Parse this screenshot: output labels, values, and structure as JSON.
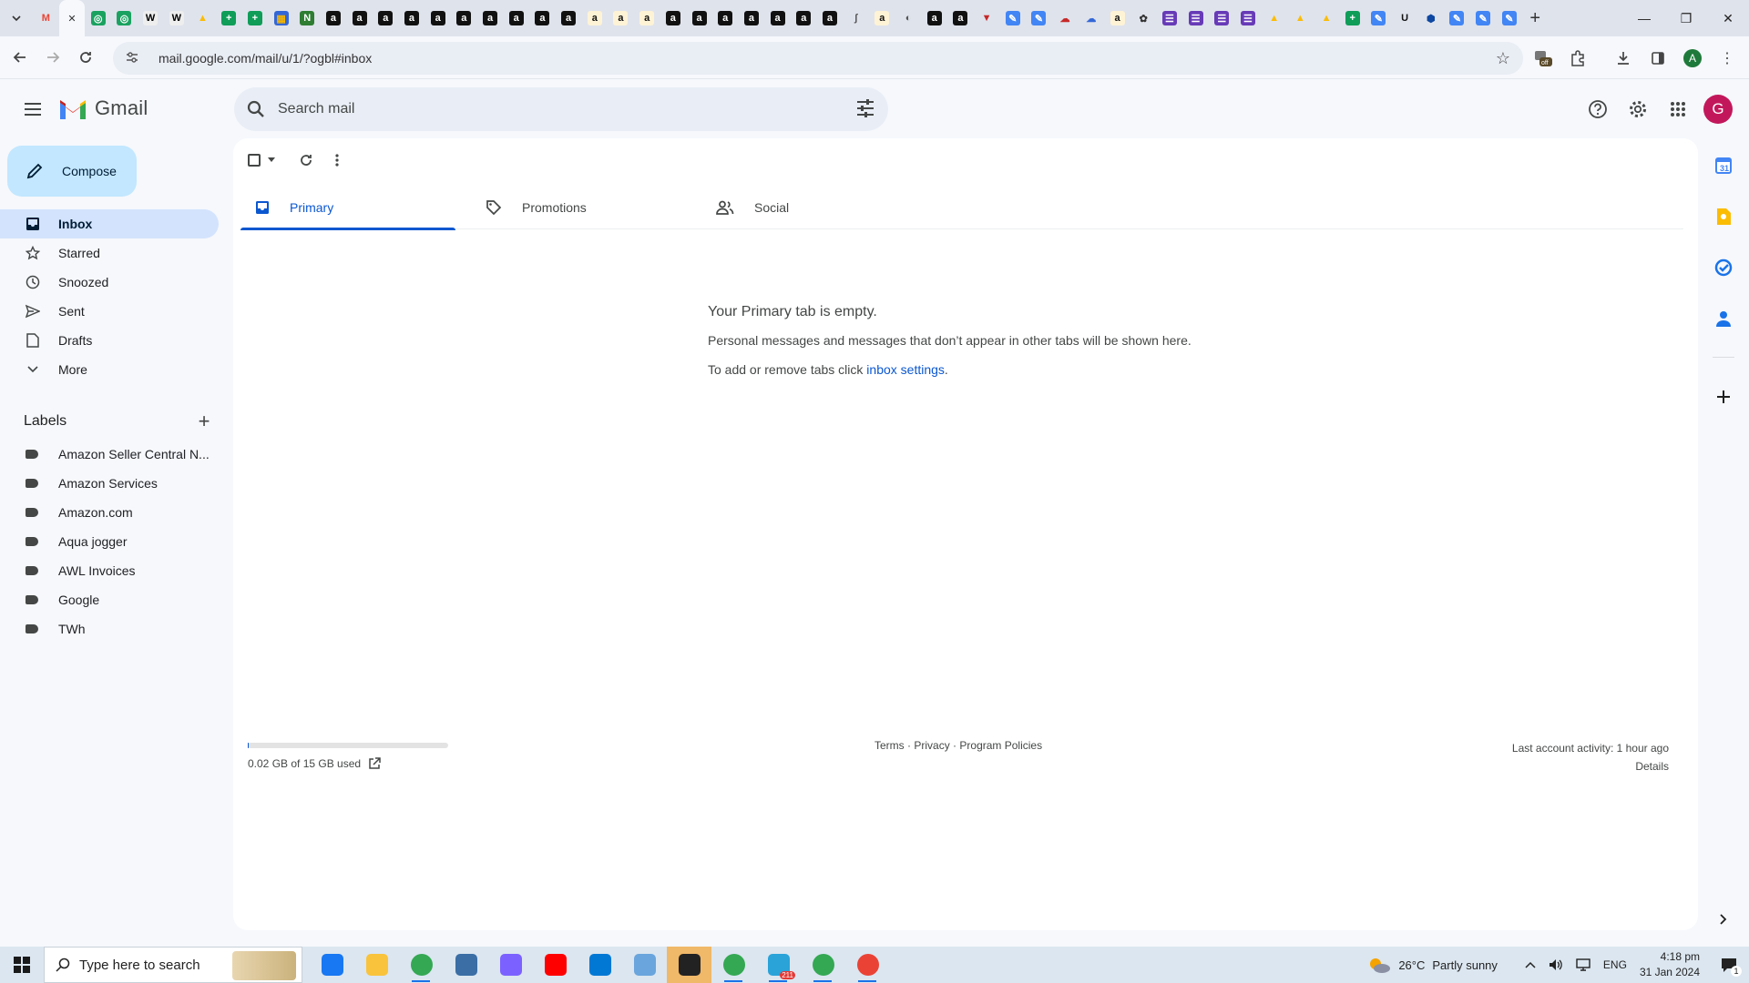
{
  "browser": {
    "url": "mail.google.com/mail/u/1/?ogbl#inbox",
    "tab_favicons": [
      {
        "icon": "gmail-icon",
        "glyph": "M",
        "color": "#ea4335",
        "bg": "transparent"
      },
      {
        "icon": "close-tab-icon",
        "glyph": "",
        "color": "#333",
        "bg": "transparent"
      },
      {
        "icon": "green-circle-icon",
        "glyph": "◎",
        "color": "#fff",
        "bg": "#1aa260"
      },
      {
        "icon": "green-circle-icon",
        "glyph": "◎",
        "color": "#fff",
        "bg": "#1aa260"
      },
      {
        "icon": "wix-icon",
        "glyph": "W",
        "color": "#000",
        "bg": "#eeeeee"
      },
      {
        "icon": "wix-icon",
        "glyph": "W",
        "color": "#000",
        "bg": "#eeeeee"
      },
      {
        "icon": "drive-icon",
        "glyph": "▲",
        "color": "#fbbc04",
        "bg": "transparent"
      },
      {
        "icon": "sheets-icon",
        "glyph": "+",
        "color": "#fff",
        "bg": "#0f9d58"
      },
      {
        "icon": "sheets-icon",
        "glyph": "+",
        "color": "#fff",
        "bg": "#0f9d58"
      },
      {
        "icon": "colorgrid-icon",
        "glyph": "▦",
        "color": "#f4b400",
        "bg": "#3367d6"
      },
      {
        "icon": "green-n-icon",
        "glyph": "N",
        "color": "#fff",
        "bg": "#2e7d32"
      },
      {
        "icon": "amazon-icon",
        "glyph": "a",
        "color": "#fff",
        "bg": "#111"
      },
      {
        "icon": "amazon-icon",
        "glyph": "a",
        "color": "#fff",
        "bg": "#111"
      },
      {
        "icon": "amazon-icon",
        "glyph": "a",
        "color": "#fff",
        "bg": "#111"
      },
      {
        "icon": "amazon-icon",
        "glyph": "a",
        "color": "#fff",
        "bg": "#111"
      },
      {
        "icon": "amazon-icon",
        "glyph": "a",
        "color": "#fff",
        "bg": "#111"
      },
      {
        "icon": "amazon-icon",
        "glyph": "a",
        "color": "#fff",
        "bg": "#111"
      },
      {
        "icon": "amazon-icon",
        "glyph": "a",
        "color": "#fff",
        "bg": "#111"
      },
      {
        "icon": "amazon-icon",
        "glyph": "a",
        "color": "#fff",
        "bg": "#111"
      },
      {
        "icon": "amazon-icon",
        "glyph": "a",
        "color": "#fff",
        "bg": "#111"
      },
      {
        "icon": "amazon-icon",
        "glyph": "a",
        "color": "#fff",
        "bg": "#111"
      },
      {
        "icon": "amazon-smile-icon",
        "glyph": "a",
        "color": "#111",
        "bg": "#fff3d6"
      },
      {
        "icon": "amazon-smile-icon",
        "glyph": "a",
        "color": "#111",
        "bg": "#fff3d6"
      },
      {
        "icon": "amazon-smile-icon",
        "glyph": "a",
        "color": "#111",
        "bg": "#fff3d6"
      },
      {
        "icon": "amazon-icon",
        "glyph": "a",
        "color": "#fff",
        "bg": "#111"
      },
      {
        "icon": "amazon-icon",
        "glyph": "a",
        "color": "#fff",
        "bg": "#111"
      },
      {
        "icon": "amazon-icon",
        "glyph": "a",
        "color": "#fff",
        "bg": "#111"
      },
      {
        "icon": "amazon-icon",
        "glyph": "a",
        "color": "#fff",
        "bg": "#111"
      },
      {
        "icon": "amazon-icon",
        "glyph": "a",
        "color": "#fff",
        "bg": "#111"
      },
      {
        "icon": "amazon-icon",
        "glyph": "a",
        "color": "#fff",
        "bg": "#111"
      },
      {
        "icon": "amazon-icon",
        "glyph": "a",
        "color": "#fff",
        "bg": "#111"
      },
      {
        "icon": "script-icon",
        "glyph": "ʃ",
        "color": "#555",
        "bg": "transparent"
      },
      {
        "icon": "amazon-smile-icon",
        "glyph": "a",
        "color": "#111",
        "bg": "#fff3d6"
      },
      {
        "icon": "globe-icon",
        "glyph": "◐",
        "color": "#555",
        "bg": "transparent"
      },
      {
        "icon": "amazon-icon",
        "glyph": "a",
        "color": "#fff",
        "bg": "#111"
      },
      {
        "icon": "amazon-icon",
        "glyph": "a",
        "color": "#fff",
        "bg": "#111"
      },
      {
        "icon": "red-v-icon",
        "glyph": "▼",
        "color": "#c62828",
        "bg": "transparent"
      },
      {
        "icon": "pencil-app-icon",
        "glyph": "✎",
        "color": "#fff",
        "bg": "#4285f4"
      },
      {
        "icon": "pencil-app-icon",
        "glyph": "✎",
        "color": "#fff",
        "bg": "#4285f4"
      },
      {
        "icon": "cloud-icon",
        "glyph": "☁",
        "color": "#c62828",
        "bg": "transparent"
      },
      {
        "icon": "cloud-icon",
        "glyph": "☁",
        "color": "#3367d6",
        "bg": "transparent"
      },
      {
        "icon": "amazon-smile-icon",
        "glyph": "a",
        "color": "#111",
        "bg": "#fff3d6"
      },
      {
        "icon": "openai-icon",
        "glyph": "✿",
        "color": "#333",
        "bg": "transparent"
      },
      {
        "icon": "forms-icon",
        "glyph": "☰",
        "color": "#fff",
        "bg": "#673ab7"
      },
      {
        "icon": "forms-icon",
        "glyph": "☰",
        "color": "#fff",
        "bg": "#673ab7"
      },
      {
        "icon": "forms-icon",
        "glyph": "☰",
        "color": "#fff",
        "bg": "#673ab7"
      },
      {
        "icon": "forms-icon",
        "glyph": "☰",
        "color": "#fff",
        "bg": "#673ab7"
      },
      {
        "icon": "drive-icon",
        "glyph": "▲",
        "color": "#fbbc04",
        "bg": "transparent"
      },
      {
        "icon": "drive-icon",
        "glyph": "▲",
        "color": "#fbbc04",
        "bg": "transparent"
      },
      {
        "icon": "drive-icon",
        "glyph": "▲",
        "color": "#fbbc04",
        "bg": "transparent"
      },
      {
        "icon": "sheets-icon",
        "glyph": "+",
        "color": "#fff",
        "bg": "#0f9d58"
      },
      {
        "icon": "pencil-app-icon",
        "glyph": "✎",
        "color": "#fff",
        "bg": "#4285f4"
      },
      {
        "icon": "u-icon",
        "glyph": "U",
        "color": "#111",
        "bg": "transparent"
      },
      {
        "icon": "hexagon-icon",
        "glyph": "⬢",
        "color": "#0d47a1",
        "bg": "transparent"
      },
      {
        "icon": "pencil-app-icon",
        "glyph": "✎",
        "color": "#fff",
        "bg": "#4285f4"
      },
      {
        "icon": "pencil-app-icon",
        "glyph": "✎",
        "color": "#fff",
        "bg": "#4285f4"
      },
      {
        "icon": "pencil-app-icon",
        "glyph": "✎",
        "color": "#fff",
        "bg": "#4285f4"
      }
    ]
  },
  "gmail": {
    "app_name": "Gmail",
    "search_placeholder": "Search mail",
    "avatar_letter": "G",
    "profile_letter": "A",
    "compose_label": "Compose",
    "nav": [
      {
        "label": "Inbox",
        "icon": "inbox-icon"
      },
      {
        "label": "Starred",
        "icon": "star-icon"
      },
      {
        "label": "Snoozed",
        "icon": "clock-icon"
      },
      {
        "label": "Sent",
        "icon": "send-icon"
      },
      {
        "label": "Drafts",
        "icon": "draft-icon"
      },
      {
        "label": "More",
        "icon": "chevron-down-icon"
      }
    ],
    "labels_heading": "Labels",
    "labels": [
      "Amazon Seller Central N...",
      "Amazon Services",
      "Amazon.com",
      "Aqua jogger",
      "AWL Invoices",
      "Google",
      "TWh"
    ],
    "tabs": [
      {
        "label": "Primary",
        "icon": "inbox-tab-icon"
      },
      {
        "label": "Promotions",
        "icon": "tag-icon"
      },
      {
        "label": "Social",
        "icon": "people-icon"
      }
    ],
    "empty": {
      "title": "Your Primary tab is empty.",
      "line1": "Personal messages and messages that don’t appear in other tabs will be shown here.",
      "line2_prefix": "To add or remove tabs click ",
      "line2_link": "inbox settings",
      "line2_suffix": "."
    },
    "footer": {
      "storage": "0.02 GB of 15 GB used",
      "storage_fraction": 0.0013,
      "terms": "Terms",
      "privacy": "Privacy",
      "policies": "Program Policies",
      "sep": "·",
      "last_activity": "Last account activity: 1 hour ago",
      "details": "Details"
    }
  },
  "taskbar": {
    "search_placeholder": "Type here to search",
    "apps": [
      {
        "icon": "facebook-icon",
        "color": "#1877f2"
      },
      {
        "icon": "file-explorer-icon",
        "color": "#f9c33c"
      },
      {
        "icon": "chrome-icon",
        "color": "#34a853"
      },
      {
        "icon": "calculator-icon",
        "color": "#3a6ea5"
      },
      {
        "icon": "copilot-icon",
        "color": "#7b61ff"
      },
      {
        "icon": "youtube-icon",
        "color": "#ff0000"
      },
      {
        "icon": "store-icon",
        "color": "#0078d4"
      },
      {
        "icon": "snipping-icon",
        "color": "#6aa5dd"
      },
      {
        "icon": "sticky-notes-icon",
        "color": "#222222"
      },
      {
        "icon": "chrome-profile-icon",
        "color": "#34a853"
      },
      {
        "icon": "telegram-icon",
        "color": "#2aa3d9"
      },
      {
        "icon": "chrome-a-icon",
        "color": "#34a853"
      },
      {
        "icon": "chrome-c-icon",
        "color": "#ea4335"
      }
    ],
    "telegram_badge": "211",
    "weather": "26°C",
    "weather_desc": "Partly sunny",
    "lang": "ENG",
    "time": "4:18 pm",
    "date": "31 Jan 2024",
    "notif_count": "1"
  }
}
